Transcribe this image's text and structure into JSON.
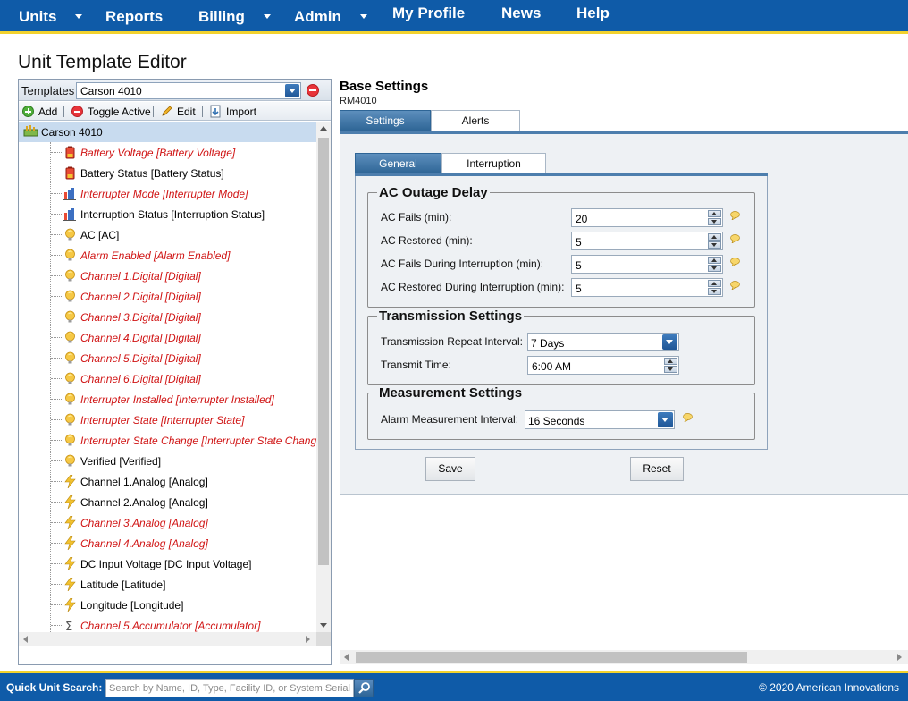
{
  "nav": {
    "items": [
      {
        "label": "Units",
        "has_menu": true
      },
      {
        "label": "Reports",
        "has_menu": false
      },
      {
        "label": "Billing",
        "has_menu": true
      },
      {
        "label": "Admin",
        "has_menu": true
      },
      {
        "label": "My Profile",
        "has_menu": false
      },
      {
        "label": "News",
        "has_menu": false
      },
      {
        "label": "Help",
        "has_menu": false
      }
    ]
  },
  "page": {
    "title": "Unit Template Editor"
  },
  "templates": {
    "label": "Templates",
    "selected": "Carson 4010",
    "toolbar": {
      "add": "Add",
      "toggle_active": "Toggle Active",
      "edit": "Edit",
      "import": "Import"
    }
  },
  "tree": {
    "root": "Carson 4010",
    "items": [
      {
        "label": "Battery Voltage [Battery Voltage]",
        "icon": "battery-icon",
        "error": true
      },
      {
        "label": "Battery Status [Battery Status]",
        "icon": "battery-icon",
        "error": false
      },
      {
        "label": "Interrupter Mode [Interrupter Mode]",
        "icon": "bar-chart-icon",
        "error": true
      },
      {
        "label": "Interruption Status [Interruption Status]",
        "icon": "bar-chart-icon",
        "error": false
      },
      {
        "label": "AC [AC]",
        "icon": "lightbulb-icon",
        "error": false
      },
      {
        "label": "Alarm Enabled [Alarm Enabled]",
        "icon": "lightbulb-icon",
        "error": true
      },
      {
        "label": "Channel 1.Digital [Digital]",
        "icon": "lightbulb-icon",
        "error": true
      },
      {
        "label": "Channel 2.Digital [Digital]",
        "icon": "lightbulb-icon",
        "error": true
      },
      {
        "label": "Channel 3.Digital [Digital]",
        "icon": "lightbulb-icon",
        "error": true
      },
      {
        "label": "Channel 4.Digital [Digital]",
        "icon": "lightbulb-icon",
        "error": true
      },
      {
        "label": "Channel 5.Digital [Digital]",
        "icon": "lightbulb-icon",
        "error": true
      },
      {
        "label": "Channel 6.Digital [Digital]",
        "icon": "lightbulb-icon",
        "error": true
      },
      {
        "label": "Interrupter Installed [Interrupter Installed]",
        "icon": "lightbulb-icon",
        "error": true
      },
      {
        "label": "Interrupter State [Interrupter State]",
        "icon": "lightbulb-icon",
        "error": true
      },
      {
        "label": "Interrupter State Change [Interrupter State Change]",
        "icon": "lightbulb-icon",
        "error": true
      },
      {
        "label": "Verified [Verified]",
        "icon": "lightbulb-icon",
        "error": false
      },
      {
        "label": "Channel 1.Analog [Analog]",
        "icon": "lightning-icon",
        "error": false
      },
      {
        "label": "Channel 2.Analog [Analog]",
        "icon": "lightning-icon",
        "error": false
      },
      {
        "label": "Channel 3.Analog [Analog]",
        "icon": "lightning-icon",
        "error": true
      },
      {
        "label": "Channel 4.Analog [Analog]",
        "icon": "lightning-icon",
        "error": true
      },
      {
        "label": "DC Input Voltage [DC Input Voltage]",
        "icon": "lightning-icon",
        "error": false
      },
      {
        "label": "Latitude [Latitude]",
        "icon": "lightning-icon",
        "error": false
      },
      {
        "label": "Longitude [Longitude]",
        "icon": "lightning-icon",
        "error": false
      },
      {
        "label": "Channel 5.Accumulator [Accumulator]",
        "icon": "sigma-icon",
        "error": true
      }
    ]
  },
  "base": {
    "title": "Base Settings",
    "model": "RM4010",
    "tabs": [
      "Settings",
      "Alerts"
    ],
    "sub_tabs": [
      "General",
      "Interruption"
    ],
    "ac_outage": {
      "legend": "AC Outage Delay",
      "fields": [
        {
          "label": "AC Fails (min):",
          "value": "20"
        },
        {
          "label": "AC Restored (min):",
          "value": "5"
        },
        {
          "label": "AC Fails During Interruption (min):",
          "value": "5"
        },
        {
          "label": "AC Restored During Interruption (min):",
          "value": "5"
        }
      ]
    },
    "transmission": {
      "legend": "Transmission Settings",
      "repeat_label": "Transmission Repeat Interval:",
      "repeat_value": "7 Days",
      "time_label": "Transmit Time:",
      "time_value": "6:00 AM"
    },
    "measurement": {
      "legend": "Measurement Settings",
      "interval_label": "Alarm Measurement Interval:",
      "interval_value": "16 Seconds"
    },
    "save": "Save",
    "reset": "Reset"
  },
  "footer": {
    "search_label": "Quick Unit Search:",
    "search_placeholder": "Search by Name, ID, Type, Facility ID, or System Serial",
    "copyright": "© 2020 American Innovations"
  },
  "colors": {
    "brand": "#0f5ba8",
    "accent": "#f2d22e",
    "error_text": "#d01515",
    "tab_active": "#2e6596"
  }
}
